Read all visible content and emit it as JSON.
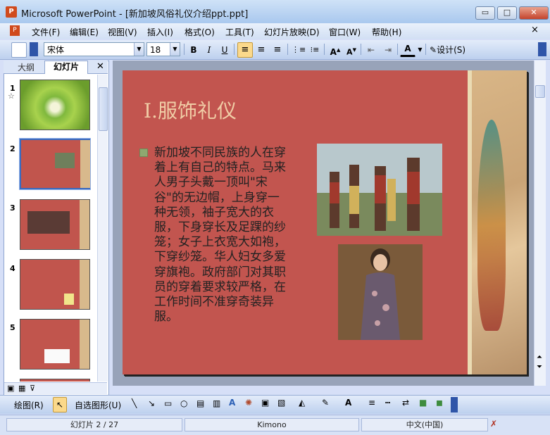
{
  "window": {
    "title": "Microsoft PowerPoint - [新加坡风俗礼仪介绍ppt.ppt]",
    "min": "▭",
    "max": "□",
    "close": "✕"
  },
  "menus": [
    "文件(F)",
    "编辑(E)",
    "视图(V)",
    "插入(I)",
    "格式(O)",
    "工具(T)",
    "幻灯片放映(D)",
    "窗口(W)",
    "帮助(H)"
  ],
  "toolbar": {
    "font": "宋体",
    "size": "18",
    "bold": "B",
    "italic": "I",
    "underline": "U",
    "design": "设计(S)"
  },
  "left_tabs": [
    "大纲",
    "幻灯片"
  ],
  "slides": [
    {
      "num": "1"
    },
    {
      "num": "2"
    },
    {
      "num": "3"
    },
    {
      "num": "4"
    },
    {
      "num": "5"
    }
  ],
  "slide": {
    "title": "Ⅰ.服饰礼仪",
    "body": "新加坡不同民族的人在穿着上有自己的特点。马来人男子头戴一顶叫\"宋谷\"的无边帽，上身穿一种无领，袖子宽大的衣服，下身穿长及足踝的纱笼；女子上衣宽大如袍，下穿纱笼。华人妇女多爱穿旗袍。政府部门对其职员的穿着要求较严格，在工作时间不准穿奇装异服。"
  },
  "drawbar": {
    "draw": "绘图(R)",
    "autoshape": "自选图形(U)"
  },
  "status": {
    "slide": "幻灯片 2 / 27",
    "design": "Kimono",
    "lang": "中文(中国)"
  }
}
